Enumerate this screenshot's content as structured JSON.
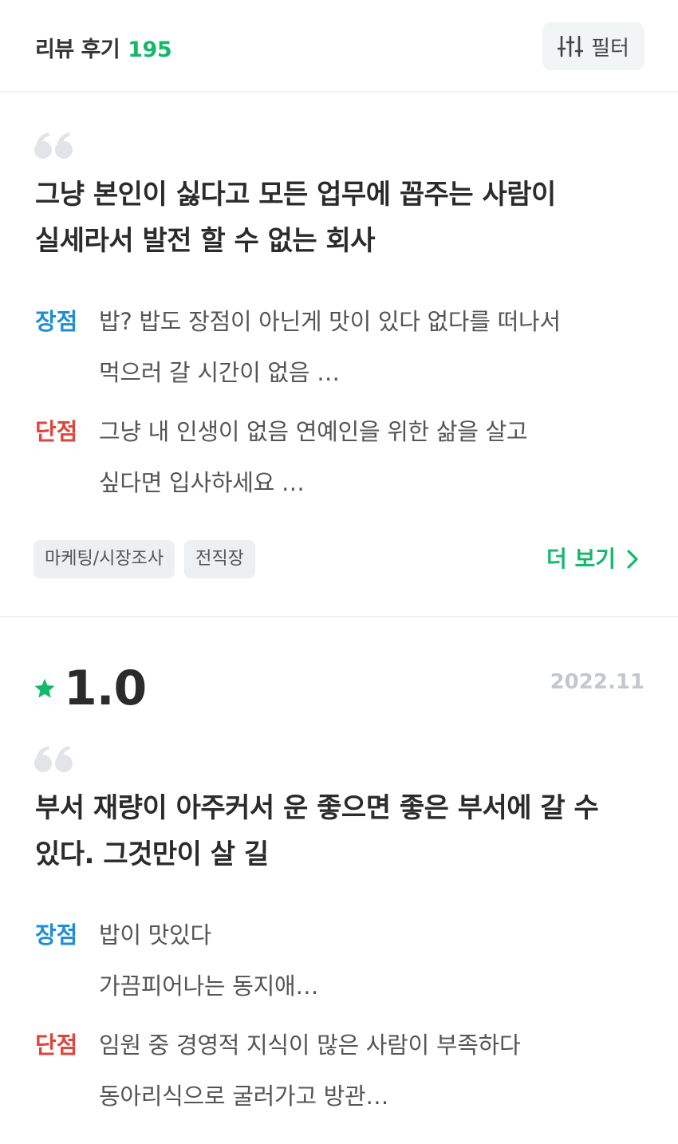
{
  "header": {
    "title": "리뷰 후기",
    "count": "195",
    "filter_label": "필터"
  },
  "reviews": [
    {
      "title_line1": "그냥 본인이 싫다고 모든 업무에 꼽주는 사람이",
      "title_line2": "실세라서 발전 할 수 없는 회사",
      "pros_label": "장점",
      "pros_line1": "밥?  밥도 장점이 아닌게 맛이 있다 없다를 떠나서",
      "pros_line2": "먹으러 갈 시간이 없음 …",
      "cons_label": "단점",
      "cons_line1": "그냥 내 인생이 없음 연예인을 위한 삶을 살고",
      "cons_line2": "싶다면 입사하세요  …",
      "tags": [
        "마케팅/시장조사",
        "전직장"
      ],
      "more_label": "더 보기"
    },
    {
      "rating": "1.0",
      "date": "2022.11",
      "title_line1": "부서 재량이 아주커서 운 좋으면 좋은 부서에 갈 수",
      "title_line2": "있다. 그것만이 살 길",
      "pros_label": "장점",
      "pros_line1": "밥이 맛있다",
      "pros_line2": "가끔피어나는 동지애…",
      "cons_label": "단점",
      "cons_line1": "임원 중 경영적 지식이 많은 사람이 부족하다",
      "cons_line2": "동아리식으로 굴러가고 방관…"
    }
  ],
  "colors": {
    "accent": "#14b86b",
    "pros": "#1f8ed6",
    "cons": "#e0443b",
    "quote_icon": "#e3e4e8",
    "date": "#c4c7cc"
  }
}
